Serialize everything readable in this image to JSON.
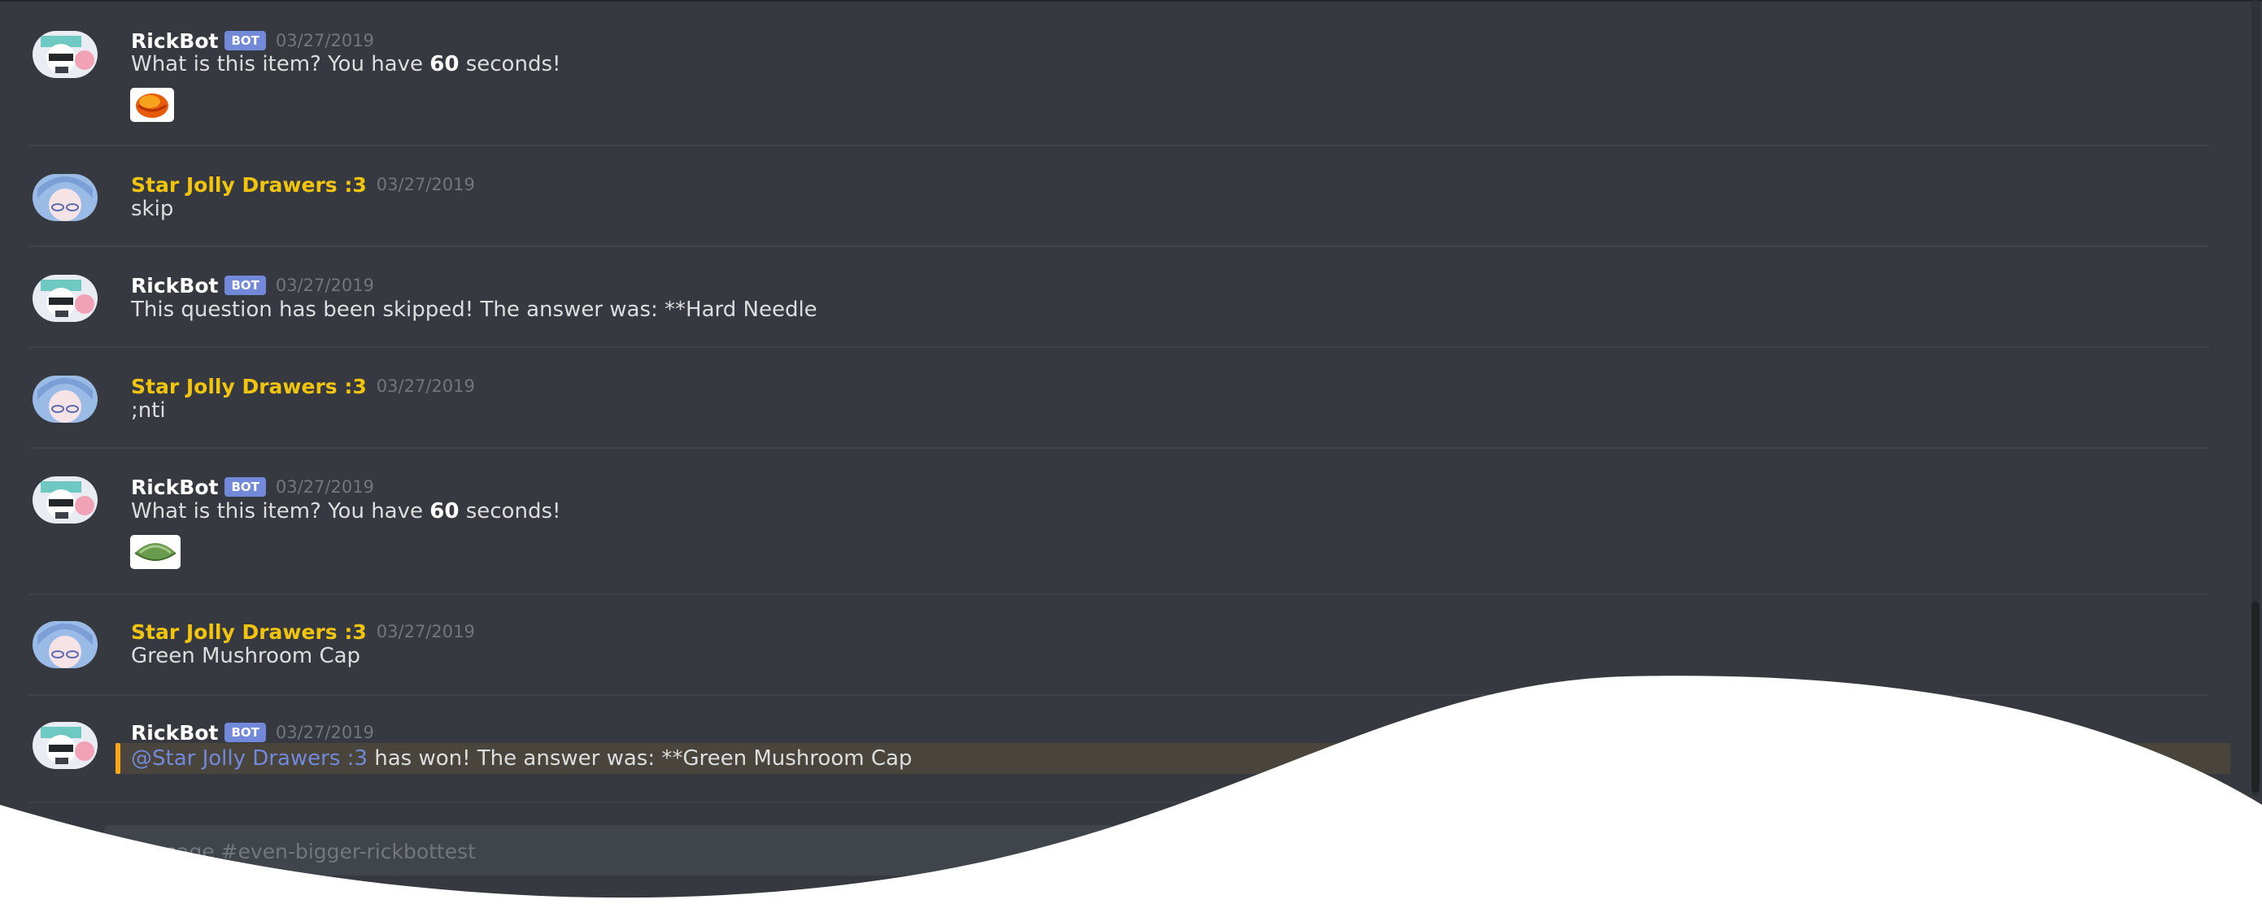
{
  "messages": [
    {
      "author": "RickBot",
      "bot_tag": "BOT",
      "timestamp": "03/27/2019",
      "text_pre": "What is this item? You have ",
      "text_bold": "60",
      "text_post": " seconds!",
      "attachment": "orange-item-emoji"
    },
    {
      "author": "Star Jolly Drawers :3",
      "timestamp": "03/27/2019",
      "text": "skip"
    },
    {
      "author": "RickBot",
      "bot_tag": "BOT",
      "timestamp": "03/27/2019",
      "text": "This question has been skipped! The answer was: **Hard Needle"
    },
    {
      "author": "Star Jolly Drawers :3",
      "timestamp": "03/27/2019",
      "text": ";nti"
    },
    {
      "author": "RickBot",
      "bot_tag": "BOT",
      "timestamp": "03/27/2019",
      "text_pre": "What is this item? You have ",
      "text_bold": "60",
      "text_post": " seconds!",
      "attachment": "green-mushroom-cap-emoji"
    },
    {
      "author": "Star Jolly Drawers :3",
      "timestamp": "03/27/2019",
      "text": "Green Mushroom Cap"
    },
    {
      "author": "RickBot",
      "bot_tag": "BOT",
      "timestamp": "03/27/2019",
      "mention": "@Star Jolly Drawers :3",
      "text": " has won! The answer was: **Green Mushroom Cap"
    }
  ],
  "composer": {
    "placeholder": "Message #even-bigger-rickbottest"
  },
  "colors": {
    "background": "#36393f",
    "bot_tag": "#7289da",
    "user_name": "#f1c40f",
    "mention_bar": "#faa61a",
    "overlay": "#ffffff"
  },
  "icons": [
    "rickbot-avatar",
    "star-jolly-avatar",
    "orange-item-emoji",
    "green-mushroom-cap-emoji"
  ]
}
